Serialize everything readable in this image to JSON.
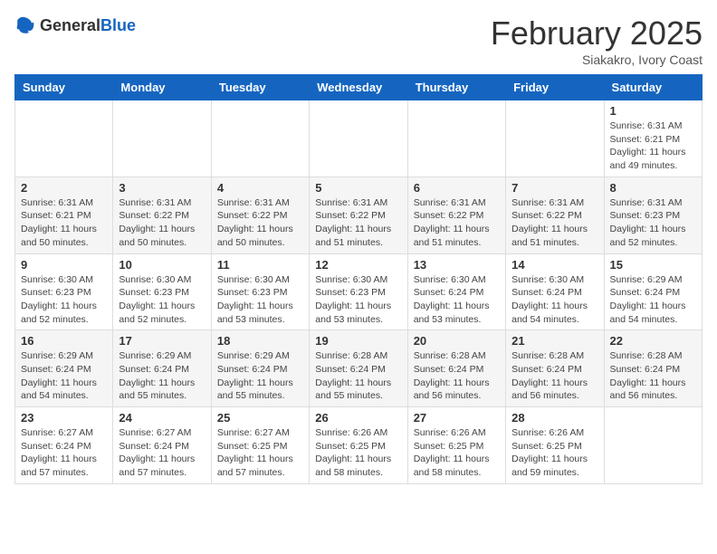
{
  "header": {
    "logo_general": "General",
    "logo_blue": "Blue",
    "month_title": "February 2025",
    "location": "Siakakro, Ivory Coast"
  },
  "weekdays": [
    "Sunday",
    "Monday",
    "Tuesday",
    "Wednesday",
    "Thursday",
    "Friday",
    "Saturday"
  ],
  "weeks": [
    [
      {
        "day": "",
        "info": ""
      },
      {
        "day": "",
        "info": ""
      },
      {
        "day": "",
        "info": ""
      },
      {
        "day": "",
        "info": ""
      },
      {
        "day": "",
        "info": ""
      },
      {
        "day": "",
        "info": ""
      },
      {
        "day": "1",
        "info": "Sunrise: 6:31 AM\nSunset: 6:21 PM\nDaylight: 11 hours and 49 minutes."
      }
    ],
    [
      {
        "day": "2",
        "info": "Sunrise: 6:31 AM\nSunset: 6:21 PM\nDaylight: 11 hours and 50 minutes."
      },
      {
        "day": "3",
        "info": "Sunrise: 6:31 AM\nSunset: 6:22 PM\nDaylight: 11 hours and 50 minutes."
      },
      {
        "day": "4",
        "info": "Sunrise: 6:31 AM\nSunset: 6:22 PM\nDaylight: 11 hours and 50 minutes."
      },
      {
        "day": "5",
        "info": "Sunrise: 6:31 AM\nSunset: 6:22 PM\nDaylight: 11 hours and 51 minutes."
      },
      {
        "day": "6",
        "info": "Sunrise: 6:31 AM\nSunset: 6:22 PM\nDaylight: 11 hours and 51 minutes."
      },
      {
        "day": "7",
        "info": "Sunrise: 6:31 AM\nSunset: 6:22 PM\nDaylight: 11 hours and 51 minutes."
      },
      {
        "day": "8",
        "info": "Sunrise: 6:31 AM\nSunset: 6:23 PM\nDaylight: 11 hours and 52 minutes."
      }
    ],
    [
      {
        "day": "9",
        "info": "Sunrise: 6:30 AM\nSunset: 6:23 PM\nDaylight: 11 hours and 52 minutes."
      },
      {
        "day": "10",
        "info": "Sunrise: 6:30 AM\nSunset: 6:23 PM\nDaylight: 11 hours and 52 minutes."
      },
      {
        "day": "11",
        "info": "Sunrise: 6:30 AM\nSunset: 6:23 PM\nDaylight: 11 hours and 53 minutes."
      },
      {
        "day": "12",
        "info": "Sunrise: 6:30 AM\nSunset: 6:23 PM\nDaylight: 11 hours and 53 minutes."
      },
      {
        "day": "13",
        "info": "Sunrise: 6:30 AM\nSunset: 6:24 PM\nDaylight: 11 hours and 53 minutes."
      },
      {
        "day": "14",
        "info": "Sunrise: 6:30 AM\nSunset: 6:24 PM\nDaylight: 11 hours and 54 minutes."
      },
      {
        "day": "15",
        "info": "Sunrise: 6:29 AM\nSunset: 6:24 PM\nDaylight: 11 hours and 54 minutes."
      }
    ],
    [
      {
        "day": "16",
        "info": "Sunrise: 6:29 AM\nSunset: 6:24 PM\nDaylight: 11 hours and 54 minutes."
      },
      {
        "day": "17",
        "info": "Sunrise: 6:29 AM\nSunset: 6:24 PM\nDaylight: 11 hours and 55 minutes."
      },
      {
        "day": "18",
        "info": "Sunrise: 6:29 AM\nSunset: 6:24 PM\nDaylight: 11 hours and 55 minutes."
      },
      {
        "day": "19",
        "info": "Sunrise: 6:28 AM\nSunset: 6:24 PM\nDaylight: 11 hours and 55 minutes."
      },
      {
        "day": "20",
        "info": "Sunrise: 6:28 AM\nSunset: 6:24 PM\nDaylight: 11 hours and 56 minutes."
      },
      {
        "day": "21",
        "info": "Sunrise: 6:28 AM\nSunset: 6:24 PM\nDaylight: 11 hours and 56 minutes."
      },
      {
        "day": "22",
        "info": "Sunrise: 6:28 AM\nSunset: 6:24 PM\nDaylight: 11 hours and 56 minutes."
      }
    ],
    [
      {
        "day": "23",
        "info": "Sunrise: 6:27 AM\nSunset: 6:24 PM\nDaylight: 11 hours and 57 minutes."
      },
      {
        "day": "24",
        "info": "Sunrise: 6:27 AM\nSunset: 6:24 PM\nDaylight: 11 hours and 57 minutes."
      },
      {
        "day": "25",
        "info": "Sunrise: 6:27 AM\nSunset: 6:25 PM\nDaylight: 11 hours and 57 minutes."
      },
      {
        "day": "26",
        "info": "Sunrise: 6:26 AM\nSunset: 6:25 PM\nDaylight: 11 hours and 58 minutes."
      },
      {
        "day": "27",
        "info": "Sunrise: 6:26 AM\nSunset: 6:25 PM\nDaylight: 11 hours and 58 minutes."
      },
      {
        "day": "28",
        "info": "Sunrise: 6:26 AM\nSunset: 6:25 PM\nDaylight: 11 hours and 59 minutes."
      },
      {
        "day": "",
        "info": ""
      }
    ]
  ]
}
